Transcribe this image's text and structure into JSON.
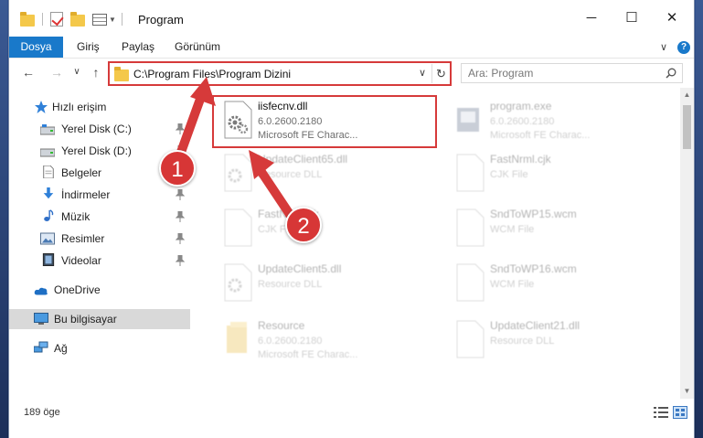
{
  "window": {
    "title": "Program",
    "minimize": "─",
    "maximize": "☐",
    "close": "✕"
  },
  "ribbon": {
    "tabs": [
      "Dosya",
      "Giriş",
      "Paylaş",
      "Görünüm"
    ],
    "expand": "∨",
    "help": "?"
  },
  "nav": {
    "back": "←",
    "forward": "→",
    "recent": "∨",
    "up": "↑",
    "address": "C:\\Program Files\\Program Dizini",
    "address_dropdown": "∨",
    "refresh": "↻",
    "search_placeholder": "Ara: Program"
  },
  "sidebar": {
    "items": [
      {
        "label": "Hızlı erişim",
        "icon": "star-icon",
        "pinned": false
      },
      {
        "label": "Yerel Disk (C:)",
        "icon": "drive-icon",
        "pinned": true
      },
      {
        "label": "Yerel Disk (D:)",
        "icon": "drive-icon",
        "pinned": true
      },
      {
        "label": "Belgeler",
        "icon": "document-icon",
        "pinned": true
      },
      {
        "label": "İndirmeler",
        "icon": "download-icon",
        "pinned": true
      },
      {
        "label": "Müzik",
        "icon": "music-icon",
        "pinned": true
      },
      {
        "label": "Resimler",
        "icon": "pictures-icon",
        "pinned": true
      },
      {
        "label": "Videolar",
        "icon": "video-icon",
        "pinned": true
      },
      {
        "label": "OneDrive",
        "icon": "cloud-icon",
        "pinned": false
      },
      {
        "label": "Bu bilgisayar",
        "icon": "computer-icon",
        "pinned": false,
        "selected": true
      },
      {
        "label": "Ağ",
        "icon": "network-icon",
        "pinned": false
      }
    ]
  },
  "files": [
    {
      "name": "iisfecnv.dll",
      "line2": "6.0.2600.2180",
      "line3": "Microsoft FE Charac...",
      "icon": "dll-gear-icon",
      "highlighted": true
    },
    {
      "name": "program.exe",
      "line2": "6.0.2600.2180",
      "line3": "Microsoft FE Charac...",
      "icon": "exe-icon"
    },
    {
      "name": "UpdateClient65.dll",
      "line2": "Resource DLL",
      "line3": "",
      "icon": "dll-gear-icon"
    },
    {
      "name": "FastNrml.cjk",
      "line2": "CJK File",
      "line3": "",
      "icon": "blank-file-icon"
    },
    {
      "name": "FastNrml.cjk",
      "line2": "CJK File",
      "line3": "",
      "icon": "blank-file-icon"
    },
    {
      "name": "SndToWP15.wcm",
      "line2": "WCM File",
      "line3": "",
      "icon": "blank-file-icon"
    },
    {
      "name": "UpdateClient5.dll",
      "line2": "Resource DLL",
      "line3": "",
      "icon": "dll-gear-icon"
    },
    {
      "name": "SndToWP16.wcm",
      "line2": "WCM File",
      "line3": "",
      "icon": "blank-file-icon"
    },
    {
      "name": "Resource",
      "line2": "6.0.2600.2180",
      "line3": "Microsoft FE Charac...",
      "icon": "folder-file-icon"
    },
    {
      "name": "UpdateClient21.dll",
      "line2": "Resource DLL",
      "line3": "",
      "icon": "blank-file-icon"
    }
  ],
  "annotations": {
    "step1": "1",
    "step2": "2",
    "accent": "#d63a3a"
  },
  "status": {
    "item_count": "189 öge"
  },
  "colors": {
    "ribbon_file_tab": "#1979ca",
    "selected_nav": "#d9d9d9"
  }
}
